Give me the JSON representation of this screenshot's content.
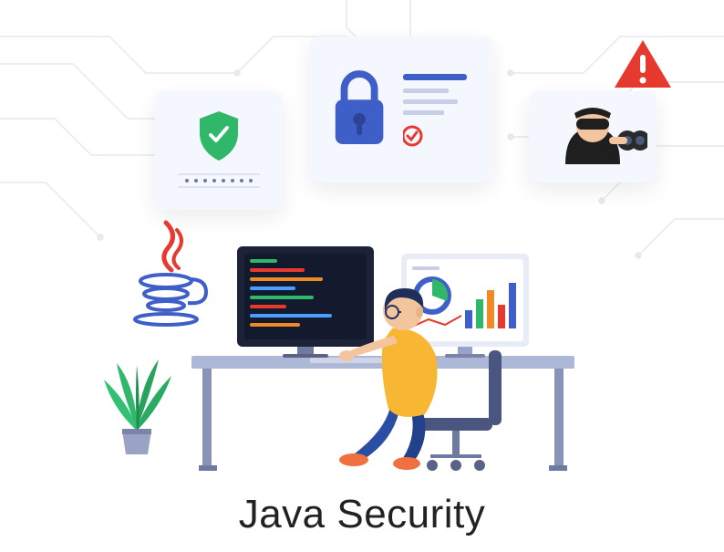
{
  "caption": "Java Security",
  "colors": {
    "accent_blue": "#3f5fc8",
    "accent_green": "#2fb86a",
    "accent_red": "#e63a2e",
    "accent_orange": "#f08a24",
    "circuit": "#e6e9f0",
    "popup_bg": "#f5f7ff",
    "desk_blue": "#adb7d6",
    "shirt": "#f7b733",
    "pants": "#2a4ea3",
    "skin": "#f2c59f",
    "hair": "#1e2f5a",
    "monitor_dark": "#1c2238"
  },
  "icons": {
    "shield": "shield-check",
    "lock": "padlock",
    "alert": "alert-triangle",
    "spy": "spy-binoculars",
    "java": "java-cup"
  }
}
